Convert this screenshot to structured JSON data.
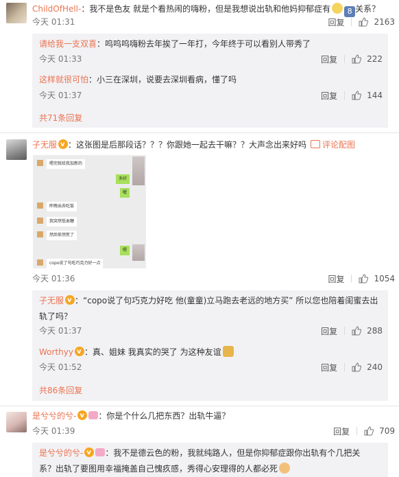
{
  "colors": {
    "username": "#eb7350",
    "time": "#777777",
    "sub_bg": "#f2f2f5",
    "text": "#333333"
  },
  "actions": {
    "reply": "回复"
  },
  "comments": [
    {
      "user": "ChildOfHell-",
      "text": "：我不是色友 就是个看热闹的嗨粉，但是我想说出轨和他妈抑郁症有",
      "text_after": "关系？",
      "level_badge": "8",
      "time": "今天 01:31",
      "likes": "2163",
      "replies": [
        {
          "user": "请给我一支双喜",
          "text": "：呜呜呜嗨粉去年挨了一年打，今年终于可以看别人带秀了",
          "time": "今天 01:33",
          "likes": "222"
        },
        {
          "user": "这样就很可怕",
          "text": "：小三在深圳，说要去深圳看病，懂了吗",
          "time": "今天 01:37",
          "likes": "144"
        }
      ],
      "more": "共71条回复"
    },
    {
      "user": "子无服",
      "text": "：这张图是后那段话？？？你跟她一起去干嘛？？大声念出来好吗",
      "pic_label": "评论配图",
      "time": "今天 01:36",
      "likes": "1054",
      "image_chat": [
        "嗯完就给我加新的",
        "多好",
        "喔",
        "昨晚出去吃饭",
        "我突然低血糖",
        "然后依然死了",
        "嗯",
        "copo说了句吃巧克力好一点"
      ],
      "replies": [
        {
          "user": "子无服",
          "text": "：“copo说了句巧克力好吃 他(童童)立马跑去老远的地方买” 所以您也陪着闺蜜去出",
          "text2": "轨了吗？",
          "time": "今天 01:37",
          "likes": "288"
        },
        {
          "user": "Worthyy",
          "text": "：真、姐妹 我真实的哭了 为这种友谊",
          "time": "今天 01:52",
          "likes": "240"
        }
      ],
      "more": "共86条回复"
    },
    {
      "user": "是兮兮的兮-",
      "text": "：你是个什么几把东西？出轨牛逼？",
      "time": "今天 01:39",
      "likes": "709",
      "replies": [
        {
          "user": "是兮兮的兮-",
          "text": "：我不是德云色的粉，我就纯路人，但是你抑郁症跟你出轨有个几把关",
          "text2": "系？出轨了要图用幸福掩盖自己愧疚感，秀得心安理得的人都必死"
        }
      ]
    }
  ]
}
